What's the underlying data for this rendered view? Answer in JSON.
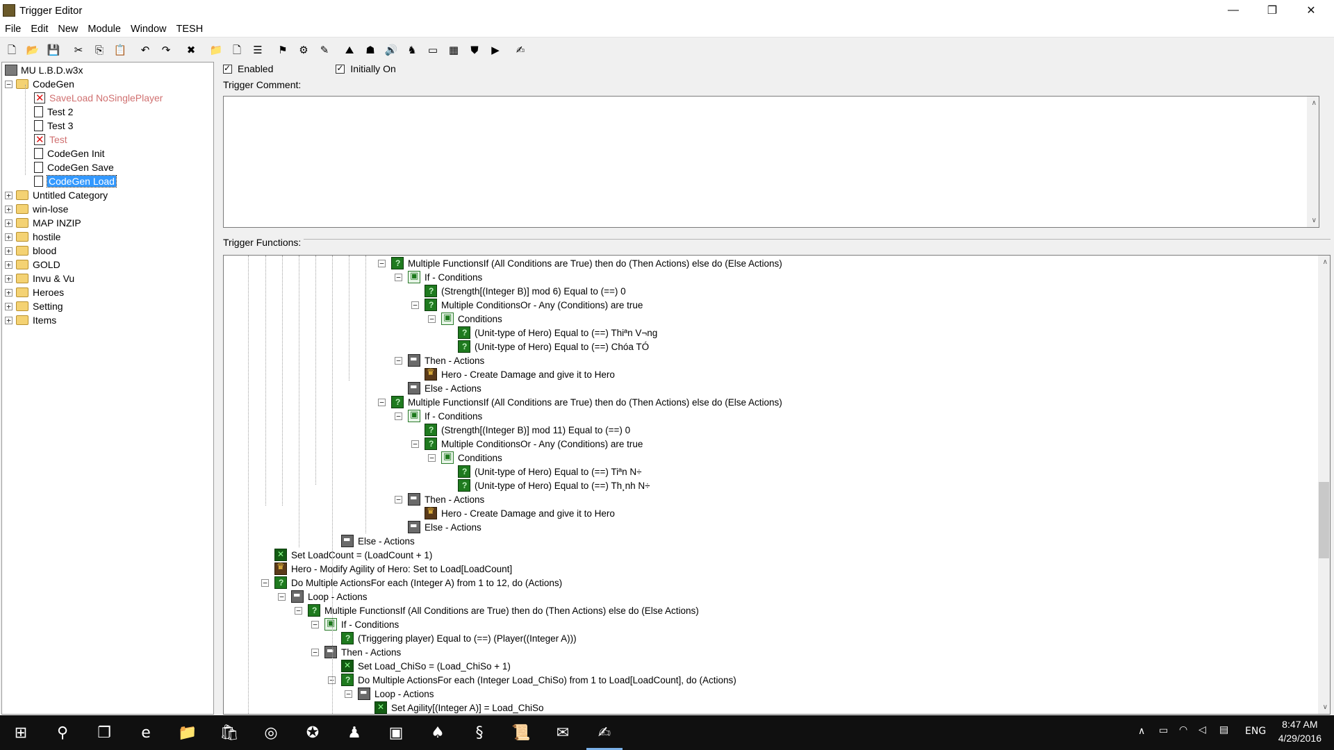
{
  "window": {
    "title": "Trigger Editor",
    "minimize": "—",
    "restore": "❐",
    "close": "✕"
  },
  "menu": [
    "File",
    "Edit",
    "New",
    "Module",
    "Window",
    "TESH"
  ],
  "toolbar": [
    {
      "name": "new-icon",
      "glyph": "🗋"
    },
    {
      "name": "open-icon",
      "glyph": "📂"
    },
    {
      "name": "save-icon",
      "glyph": "💾"
    },
    {
      "sep": true
    },
    {
      "name": "cut-icon",
      "glyph": "✂"
    },
    {
      "name": "copy-icon",
      "glyph": "⎘"
    },
    {
      "name": "paste-icon",
      "glyph": "📋"
    },
    {
      "sep": true
    },
    {
      "name": "undo-icon",
      "glyph": "↶"
    },
    {
      "name": "redo-icon",
      "glyph": "↷"
    },
    {
      "sep": true
    },
    {
      "name": "delete-icon",
      "glyph": "✖"
    },
    {
      "sep": true
    },
    {
      "name": "new-category-icon",
      "glyph": "📁"
    },
    {
      "name": "new-trigger-icon",
      "glyph": "🗋"
    },
    {
      "name": "new-comment-icon",
      "glyph": "☰"
    },
    {
      "sep": true
    },
    {
      "name": "new-event-icon",
      "glyph": "⚑"
    },
    {
      "name": "new-condition-icon",
      "glyph": "⚙"
    },
    {
      "name": "new-action-icon",
      "glyph": "✎"
    },
    {
      "sep": true
    },
    {
      "name": "terrain-editor-icon",
      "glyph": "⛰"
    },
    {
      "name": "unit-editor-icon",
      "glyph": "☗"
    },
    {
      "name": "sound-editor-icon",
      "glyph": "🔊"
    },
    {
      "name": "object-editor-icon",
      "glyph": "♞"
    },
    {
      "name": "campaign-editor-icon",
      "glyph": "▭"
    },
    {
      "name": "ai-editor-icon",
      "glyph": "▦"
    },
    {
      "name": "import-manager-icon",
      "glyph": "⛊"
    },
    {
      "name": "test-map-icon",
      "glyph": "▶"
    },
    {
      "sep": true
    },
    {
      "name": "trigger-editor-icon",
      "glyph": "✍"
    }
  ],
  "left_tree": {
    "root": "MU L.B.D.w3x",
    "codegen": {
      "label": "CodeGen",
      "children": [
        {
          "label": "SaveLoad NoSinglePlayer",
          "disabled": true
        },
        {
          "label": "Test 2",
          "disabled": false
        },
        {
          "label": "Test 3",
          "disabled": false
        },
        {
          "label": "Test",
          "disabled": true
        },
        {
          "label": "CodeGen Init",
          "disabled": false
        },
        {
          "label": "CodeGen Save",
          "disabled": false
        },
        {
          "label": "CodeGen Load",
          "disabled": false,
          "selected": true
        }
      ]
    },
    "categories": [
      "Untitled Category",
      "win-lose",
      "MAP INZIP",
      "hostile",
      "blood",
      "GOLD",
      "Invu & Vu",
      "Heroes",
      "Setting",
      "Items"
    ]
  },
  "trigger": {
    "enabled_label": "Enabled",
    "enabled": true,
    "initially_on_label": "Initially On",
    "initially_on": true,
    "comment_label": "Trigger Comment:",
    "comment": "",
    "functions_label": "Trigger Functions:"
  },
  "functions": [
    {
      "i": 8,
      "icon": "q",
      "exp": "−",
      "t": "Multiple FunctionsIf (All Conditions are True) then do (Then Actions) else do (Else Actions)"
    },
    {
      "i": 9,
      "icon": "cond",
      "exp": "−",
      "t": "If - Conditions"
    },
    {
      "i": 10,
      "icon": "q",
      "t": "(Strength[(Integer B)] mod 6) Equal to (==) 0"
    },
    {
      "i": 10,
      "icon": "q",
      "exp": "−",
      "t": "Multiple ConditionsOr - Any (Conditions) are true"
    },
    {
      "i": 11,
      "icon": "cond",
      "exp": "−",
      "t": "Conditions"
    },
    {
      "i": 12,
      "icon": "q",
      "t": "(Unit-type of Hero) Equal to (==) Thiªn V¬ng"
    },
    {
      "i": 12,
      "icon": "q",
      "t": "(Unit-type of Hero) Equal to (==) Chóa TÓ"
    },
    {
      "i": 9,
      "icon": "act",
      "exp": "−",
      "t": "Then - Actions"
    },
    {
      "i": 10,
      "icon": "hero",
      "t": "Hero - Create Damage and give it to Hero"
    },
    {
      "i": 9,
      "icon": "act",
      "t": "Else - Actions"
    },
    {
      "i": 8,
      "icon": "q",
      "exp": "−",
      "t": "Multiple FunctionsIf (All Conditions are True) then do (Then Actions) else do (Else Actions)"
    },
    {
      "i": 9,
      "icon": "cond",
      "exp": "−",
      "t": "If - Conditions"
    },
    {
      "i": 10,
      "icon": "q",
      "t": "(Strength[(Integer B)] mod 11) Equal to (==) 0"
    },
    {
      "i": 10,
      "icon": "q",
      "exp": "−",
      "t": "Multiple ConditionsOr - Any (Conditions) are true"
    },
    {
      "i": 11,
      "icon": "cond",
      "exp": "−",
      "t": "Conditions"
    },
    {
      "i": 12,
      "icon": "q",
      "t": "(Unit-type of Hero) Equal to (==) Tiªn N÷"
    },
    {
      "i": 12,
      "icon": "q",
      "t": "(Unit-type of Hero) Equal to (==) Th¸nh N÷"
    },
    {
      "i": 9,
      "icon": "act",
      "exp": "−",
      "t": "Then - Actions"
    },
    {
      "i": 10,
      "icon": "hero",
      "t": "Hero - Create Damage and give it to Hero"
    },
    {
      "i": 9,
      "icon": "act",
      "t": "Else - Actions"
    },
    {
      "i": 5,
      "icon": "act",
      "t": "Else - Actions"
    },
    {
      "i": 1,
      "icon": "x",
      "t": "Set LoadCount = (LoadCount + 1)"
    },
    {
      "i": 1,
      "icon": "hero",
      "t": "Hero - Modify Agility of Hero: Set to Load[LoadCount]"
    },
    {
      "i": 1,
      "icon": "q",
      "exp": "−",
      "t": "Do Multiple ActionsFor each (Integer A) from 1 to 12, do (Actions)"
    },
    {
      "i": 2,
      "icon": "act",
      "exp": "−",
      "t": "Loop - Actions"
    },
    {
      "i": 3,
      "icon": "q",
      "exp": "−",
      "t": "Multiple FunctionsIf (All Conditions are True) then do (Then Actions) else do (Else Actions)"
    },
    {
      "i": 4,
      "icon": "cond",
      "exp": "−",
      "t": "If - Conditions"
    },
    {
      "i": 5,
      "icon": "q",
      "t": "(Triggering player) Equal to (==) (Player((Integer A)))"
    },
    {
      "i": 4,
      "icon": "act",
      "exp": "−",
      "t": "Then - Actions"
    },
    {
      "i": 5,
      "icon": "x",
      "t": "Set Load_ChiSo = (Load_ChiSo + 1)"
    },
    {
      "i": 5,
      "icon": "q",
      "exp": "−",
      "t": "Do Multiple ActionsFor each (Integer Load_ChiSo) from 1 to Load[LoadCount], do (Actions)"
    },
    {
      "i": 6,
      "icon": "act",
      "exp": "−",
      "t": "Loop - Actions"
    },
    {
      "i": 7,
      "icon": "x",
      "t": "Set Agility[(Integer A)] = Load_ChiSo"
    }
  ],
  "taskbar": {
    "items": [
      {
        "name": "start-icon",
        "glyph": "⊞"
      },
      {
        "name": "search-icon",
        "glyph": "⚲"
      },
      {
        "name": "task-view-icon",
        "glyph": "❐"
      },
      {
        "name": "edge-icon",
        "glyph": "e"
      },
      {
        "name": "file-explorer-icon",
        "glyph": "📁"
      },
      {
        "name": "store-icon",
        "glyph": "🛍"
      },
      {
        "name": "browser-icon",
        "glyph": "◎"
      },
      {
        "name": "app-red-icon",
        "glyph": "✪"
      },
      {
        "name": "app-figure-icon",
        "glyph": "♟"
      },
      {
        "name": "app-green-icon",
        "glyph": "▣"
      },
      {
        "name": "app-cards-icon",
        "glyph": "♠"
      },
      {
        "name": "app-swirl-icon",
        "glyph": "§"
      },
      {
        "name": "app-scroll-icon",
        "glyph": "📜"
      },
      {
        "name": "app-mail-icon",
        "glyph": "✉"
      },
      {
        "name": "world-editor-icon",
        "glyph": "✍",
        "active": true
      }
    ],
    "lang": "ENG",
    "time": "8:47 AM",
    "date": "4/29/2016"
  }
}
